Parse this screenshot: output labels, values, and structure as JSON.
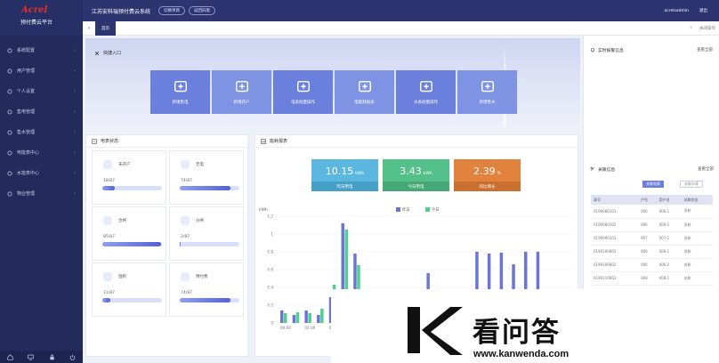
{
  "brand": {
    "name": "Acrel",
    "subtitle": "预付费云平台",
    "color": "#e03030"
  },
  "sidebar": {
    "items": [
      {
        "label": "系统配置",
        "icon": "gear-icon"
      },
      {
        "label": "用户管理",
        "icon": "user-icon"
      },
      {
        "label": "个人设置",
        "icon": "person-icon"
      },
      {
        "label": "售电管理",
        "icon": "bolt-icon"
      },
      {
        "label": "售水管理",
        "icon": "water-icon"
      },
      {
        "label": "电能表中心",
        "icon": "meter-icon"
      },
      {
        "label": "水能表中心",
        "icon": "water-meter-icon"
      },
      {
        "label": "物业管理",
        "icon": "building-icon"
      }
    ],
    "footer_icons": [
      "home-icon",
      "monitor-icon",
      "lock-icon",
      "power-icon"
    ]
  },
  "header": {
    "title": "江苏安科瑞预付费云系统",
    "pills": [
      "切换项目",
      "返回旧版"
    ],
    "user": "acrelsadmin",
    "logout": "退出"
  },
  "tabs": {
    "home": "首页",
    "close_ops": "关闭操作"
  },
  "quick": {
    "title": "快捷入口",
    "buttons": [
      {
        "label": "新增售电",
        "icon": "add-sale-icon"
      },
      {
        "label": "新增开户",
        "icon": "add-user-icon"
      },
      {
        "label": "电表批量操作",
        "icon": "batch-meter-icon"
      },
      {
        "label": "电能耗报表",
        "icon": "report-icon"
      },
      {
        "label": "水表批量操作",
        "icon": "batch-water-icon"
      },
      {
        "label": "新增售水",
        "icon": "add-water-icon"
      }
    ]
  },
  "meter_status": {
    "title": "电表状态",
    "cells": [
      {
        "label": "未开户",
        "value": "18/87",
        "fraction": 0.21
      },
      {
        "label": "无电",
        "value": "74/87",
        "fraction": 0.85
      },
      {
        "label": "合闸",
        "value": "85/87",
        "fraction": 0.98
      },
      {
        "label": "分闸",
        "value": "2/87",
        "fraction": 0.02
      },
      {
        "label": "囤积",
        "value": "11/87",
        "fraction": 0.13
      },
      {
        "label": "预付费",
        "value": "74/87",
        "fraction": 0.85
      }
    ]
  },
  "energy": {
    "title": "能耗报表",
    "stats": [
      {
        "value": "10.15",
        "unit": "kWh",
        "label": "昨日用电",
        "color": "#5bb7e0",
        "foot": "#46a0c6"
      },
      {
        "value": "3.43",
        "unit": "kWh",
        "label": "今日用电",
        "color": "#54c18a",
        "foot": "#45a876"
      },
      {
        "value": "2.39",
        "unit": "%",
        "label": "同比增长",
        "color": "#e1833f",
        "foot": "#c96f30"
      }
    ]
  },
  "chart_data": {
    "type": "bar",
    "ylabel": "kWh",
    "ylim": [
      0,
      1.2
    ],
    "yticks": [
      "1.2",
      "1",
      "0.8",
      "0.6",
      "0.4",
      "0.2",
      "0"
    ],
    "xticks": [
      "00:00",
      "02:00",
      "04:0"
    ],
    "series": [
      {
        "name": "昨日",
        "color": "#6c74d9",
        "values": [
          0.14,
          0.09,
          0.14,
          0.09,
          0.29,
          1.12,
          0.78,
          0.17,
          0.02,
          0.03,
          0.1,
          0.02,
          0.56,
          0.05,
          0.1,
          0.25,
          0.8,
          0.78,
          0.79,
          0.66,
          0.8,
          0.8,
          0.3,
          0.02
        ]
      },
      {
        "name": "今日",
        "color": "#4fcf8e",
        "values": [
          0.11,
          0.12,
          0.11,
          0.16,
          0.43,
          1.05,
          0.65,
          0.27,
          0,
          0,
          0,
          0,
          0,
          0,
          0,
          0,
          0,
          0,
          0,
          0,
          0,
          0,
          0,
          0
        ]
      }
    ]
  },
  "realtime": {
    "title": "实时报警信息",
    "link": "查看全部"
  },
  "fault": {
    "title": "关联信息",
    "link": "查看全部",
    "btn_active": "关联电表",
    "btn_inactive": "关联水表",
    "columns": [
      "表号",
      "户号",
      "用户名",
      "关联状态"
    ],
    "rows": [
      [
        "0190080101",
        "006",
        "006-1",
        "关联"
      ],
      [
        "0190080102",
        "006",
        "006-2",
        "关联"
      ],
      [
        "0190090101",
        "007",
        "007-1",
        "关联"
      ],
      [
        "0190100801",
        "006",
        "006-1",
        "关联"
      ],
      [
        "0190100802",
        "006",
        "006-2",
        "关联"
      ],
      [
        "0190110801",
        "008",
        "008-1",
        "关联"
      ]
    ]
  },
  "watermark": {
    "cn": "看问答",
    "en": "www.kanwenda.com"
  }
}
